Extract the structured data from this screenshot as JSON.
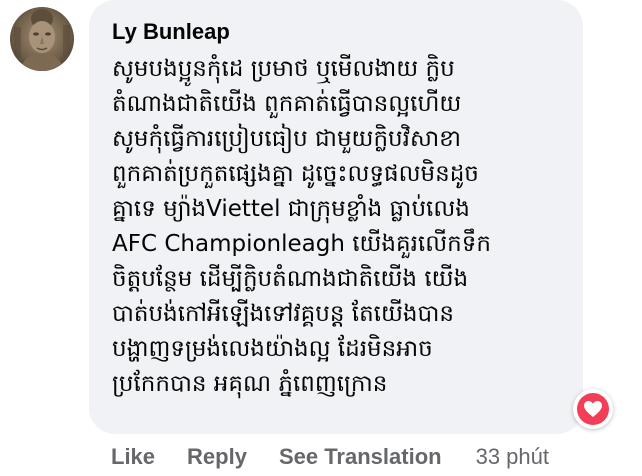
{
  "comment": {
    "author": "Ly Bunleap",
    "lines": [
      "សូមបងប្អូនកុំដេ ប្រមាថ ឬមើលងាយ ក្លិប",
      "តំណាងជាតិយើង ពួកគាត់ធ្វើបានល្អហើយ",
      "សូមកុំធ្វើការប្រៀបធៀប ជាមួយក្លិបវិសាខា",
      "ពួកគាត់ប្រកួតផ្សេងគ្នា ដូច្នេះលទ្ធផលមិនដូច",
      "គ្នាទេ ម្យ៉ាងViettel ជាក្រុមខ្លាំង ធ្លាប់លេង",
      "AFC Championleagh យើងគួរលើកទឹក",
      "ចិត្តបន្ថែម ដើម្បីក្លិបតំណាងជាតិយើង យើង",
      "បាត់បង់កៅអីឡើងទៅវគ្គបន្ត តែយើងបាន",
      "បង្ហាញទម្រង់លេងយ៉ាងល្អ ដែរមិនអាច",
      "ប្រកែកបាន អគុណ ភ្នំពេញក្រោន"
    ],
    "reaction_icon": "love-heart-icon",
    "reaction_color": "#f33e58"
  },
  "actions": {
    "like_label": "Like",
    "reply_label": "Reply",
    "translate_label": "See Translation",
    "timestamp": "33 phút"
  },
  "colors": {
    "bubble_bg": "#f0f2f5",
    "text": "#050505",
    "secondary_text": "#65676b"
  }
}
